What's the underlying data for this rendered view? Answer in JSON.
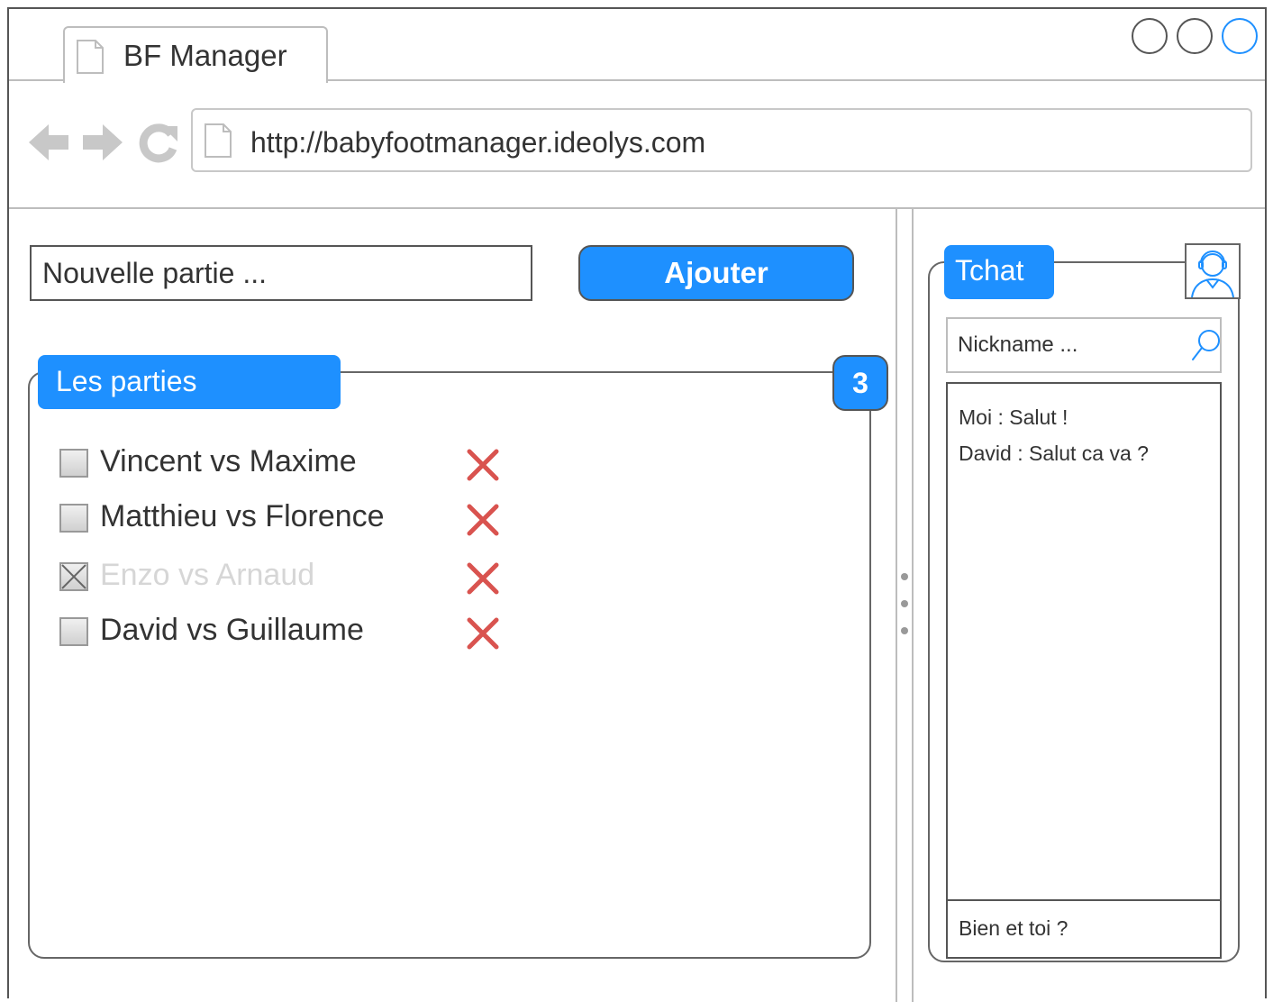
{
  "window": {
    "tab_title": "BF Manager",
    "url": "http://babyfootmanager.ideolys.com"
  },
  "controls": {
    "new_match_placeholder": "Nouvelle partie ...",
    "add_label": "Ajouter"
  },
  "matches_panel": {
    "title": "Les parties",
    "count": "3",
    "items": [
      {
        "label": "Vincent vs Maxime",
        "done": false
      },
      {
        "label": "Matthieu vs Florence",
        "done": false
      },
      {
        "label": "Enzo vs Arnaud",
        "done": true
      },
      {
        "label": "David vs Guillaume",
        "done": false
      }
    ]
  },
  "chat": {
    "title": "Tchat",
    "nickname_placeholder": "Nickname ...",
    "messages": [
      "Moi :  Salut !",
      "David : Salut ca va ?"
    ],
    "reply_text": "Bien et toi ?"
  },
  "colors": {
    "accent": "#1e90ff",
    "delete": "#d9534f"
  },
  "icons": {
    "back": "arrow-left-icon",
    "forward": "arrow-right-icon",
    "reload": "reload-icon",
    "search": "search-icon",
    "delete": "close-icon",
    "avatar": "user-avatar-icon"
  }
}
